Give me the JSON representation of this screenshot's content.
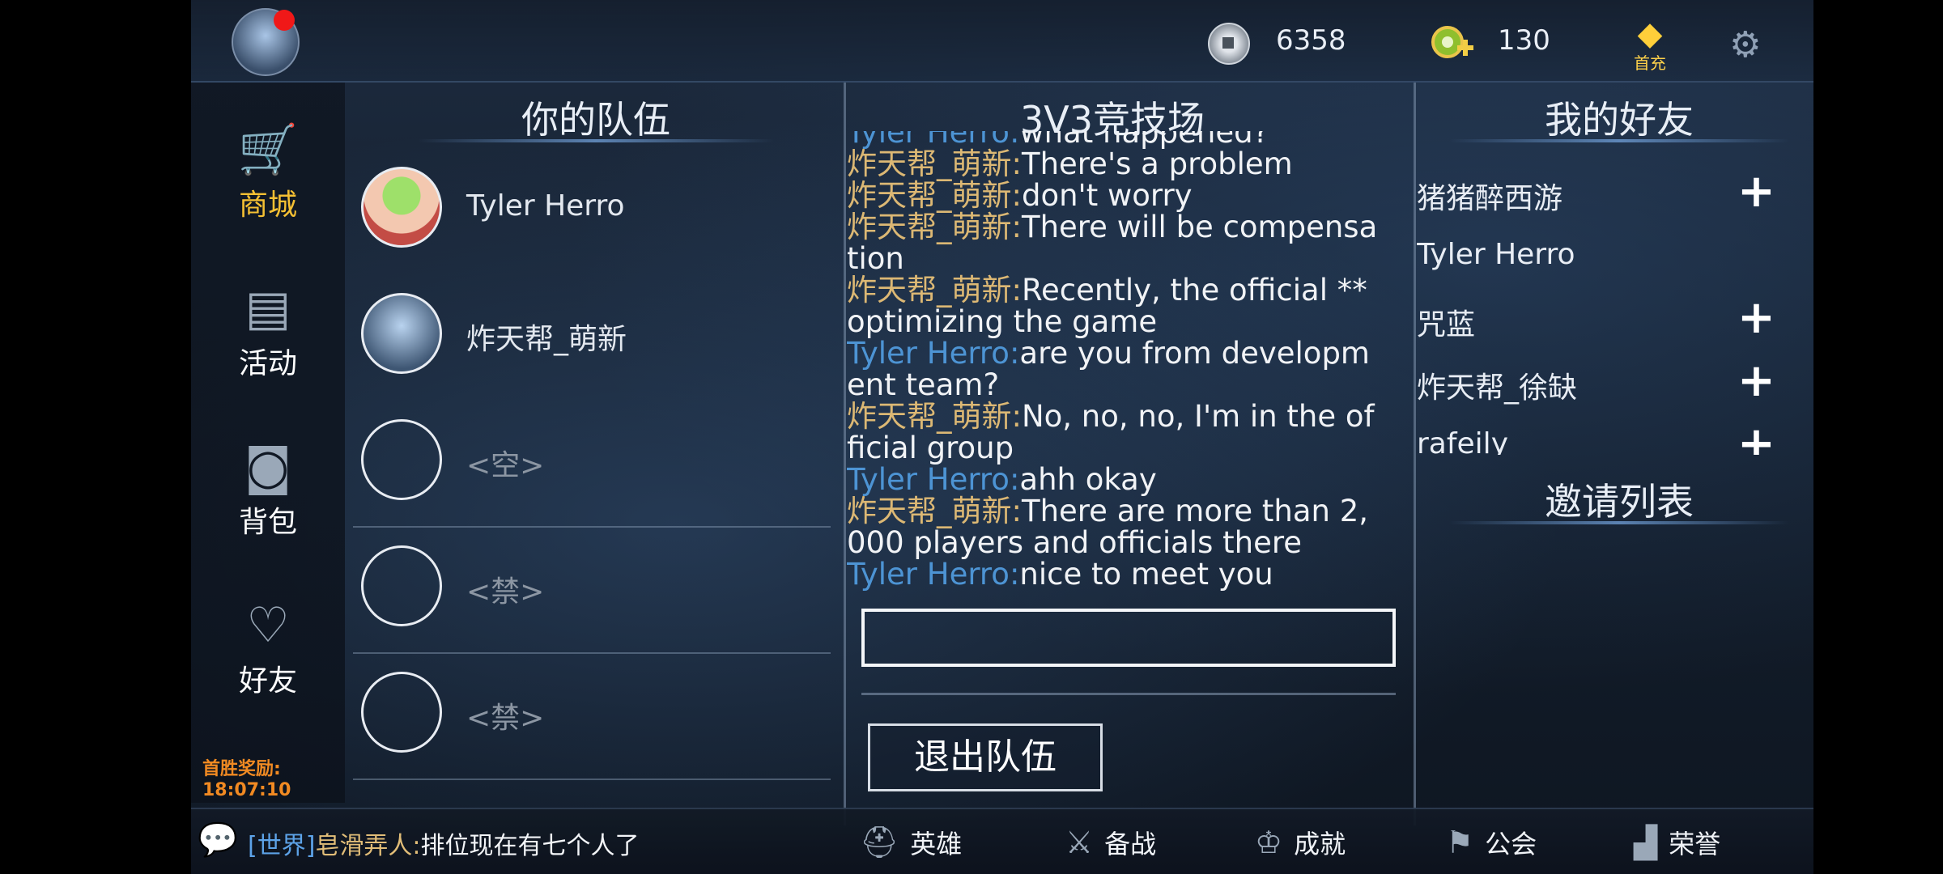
{
  "topbar": {
    "coins": "6358",
    "gems": "130",
    "first_pay_label": "首充"
  },
  "leftnav": {
    "items": [
      {
        "label": "商城",
        "icon": "cart-icon",
        "active": true
      },
      {
        "label": "活动",
        "icon": "notepad-icon"
      },
      {
        "label": "背包",
        "icon": "bag-icon"
      },
      {
        "label": "好友",
        "icon": "hearts-icon"
      }
    ],
    "reward_label": "首胜奖励:",
    "reward_time": "18:07:10"
  },
  "team": {
    "title": "你的队伍",
    "members": [
      {
        "name": "Tyler Herro"
      },
      {
        "name": "炸天帮_萌新"
      },
      {
        "name": "<空>"
      },
      {
        "name": "<禁>"
      },
      {
        "name": "<禁>"
      }
    ]
  },
  "arena": {
    "title": "3V3竞技场",
    "chat": [
      {
        "speaker": "Tyler Herro",
        "text": "what happened?"
      },
      {
        "speaker": "炸天帮_萌新",
        "text": "There's a problem"
      },
      {
        "speaker": "炸天帮_萌新",
        "text": "don't worry"
      },
      {
        "speaker": "炸天帮_萌新",
        "text": "There will be compensation"
      },
      {
        "speaker": "炸天帮_萌新",
        "text": "Recently, the official ** optimizing the game"
      },
      {
        "speaker": "Tyler Herro",
        "text": "are you from development team?"
      },
      {
        "speaker": "炸天帮_萌新",
        "text": "No, no, no, I'm in the official group"
      },
      {
        "speaker": "Tyler Herro",
        "text": "ahh okay"
      },
      {
        "speaker": "炸天帮_萌新",
        "text": "There are more than 2,000 players and officials there"
      },
      {
        "speaker": "Tyler Herro",
        "text": "nice to meet you"
      }
    ],
    "input_value": "",
    "leave_button": "退出队伍"
  },
  "friends": {
    "title": "我的好友",
    "list": [
      {
        "name": "猪猪醉西游",
        "add": "+"
      },
      {
        "name": "Tyler Herro",
        "add": ""
      },
      {
        "name": "咒蓝",
        "add": "+"
      },
      {
        "name": "炸天帮_徐缺",
        "add": "+"
      },
      {
        "name": "rafeily",
        "add": "+"
      }
    ],
    "invite_title": "邀请列表"
  },
  "bottombar": {
    "world_channel": "[世界]",
    "world_speaker": "皂滑弄人:",
    "world_text": "排位现在有七个人了",
    "nav": [
      {
        "label": "英雄",
        "icon": "helmet-icon"
      },
      {
        "label": "备战",
        "icon": "sword-icon"
      },
      {
        "label": "成就",
        "icon": "trophy-icon"
      },
      {
        "label": "公会",
        "icon": "banner-icon"
      },
      {
        "label": "荣誉",
        "icon": "podium-icon"
      }
    ]
  }
}
